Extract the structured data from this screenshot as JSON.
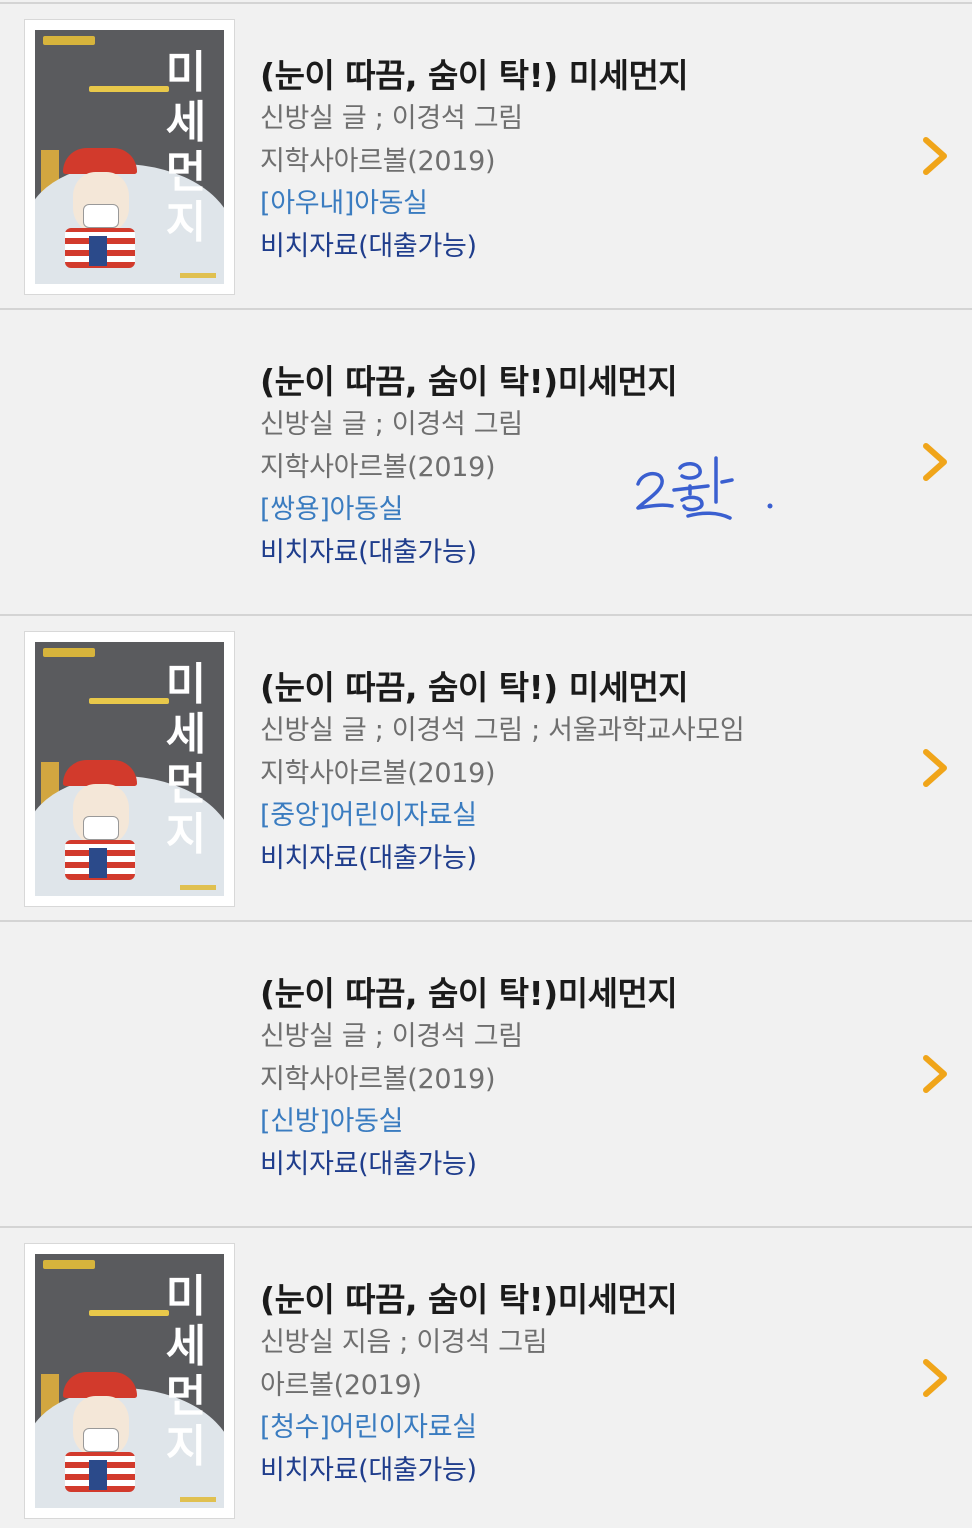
{
  "results": [
    {
      "title": "(눈이 따끔, 숨이 탁!) 미세먼지",
      "author": "신방실 글 ; 이경석 그림",
      "publisher": "지학사아르볼(2019)",
      "location": "[아우내]아동실",
      "status": "비치자료(대출가능)",
      "has_cover": true,
      "cover_title": "미세먼지"
    },
    {
      "title": "(눈이 따끔, 숨이 탁!)미세먼지",
      "author": "신방실 글 ; 이경석 그림",
      "publisher": "지학사아르볼(2019)",
      "location": "[쌍용]아동실",
      "status": "비치자료(대출가능)",
      "has_cover": false
    },
    {
      "title": "(눈이 따끔, 숨이 탁!) 미세먼지",
      "author": "신방실 글 ; 이경석 그림 ; 서울과학교사모임",
      "publisher": "지학사아르볼(2019)",
      "location": "[중앙]어린이자료실",
      "status": "비치자료(대출가능)",
      "has_cover": true,
      "cover_title": "미세먼지"
    },
    {
      "title": "(눈이 따끔, 숨이 탁!)미세먼지",
      "author": "신방실 글 ; 이경석 그림",
      "publisher": "지학사아르볼(2019)",
      "location": "[신방]아동실",
      "status": "비치자료(대출가능)",
      "has_cover": false
    },
    {
      "title": "(눈이 따끔, 숨이 탁!)미세먼지",
      "author": "신방실 지음 ; 이경석 그림",
      "publisher": "아르볼(2019)",
      "location": "[청수]어린이자료실",
      "status": "비치자료(대출가능)",
      "has_cover": true,
      "cover_title": "미세먼지"
    }
  ],
  "handwritten_note": "2권.",
  "colors": {
    "background": "#f1f1f1",
    "divider": "#d4d4d4",
    "title": "#1b1b1b",
    "meta": "#6f6f6f",
    "location": "#3a7cc0",
    "status": "#1f3d8c",
    "chevron": "#f0a51a",
    "handwriting": "#3a5fd0"
  },
  "icons": {
    "row_arrow": "chevron-right-icon"
  }
}
